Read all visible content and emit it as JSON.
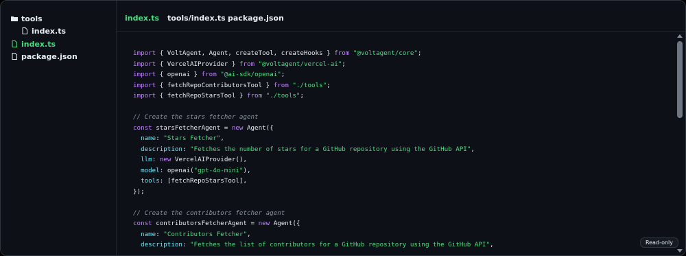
{
  "sidebar": {
    "items": [
      {
        "label": "tools",
        "icon": "folder-icon"
      },
      {
        "label": "index.ts",
        "icon": "file-icon"
      },
      {
        "label": "index.ts",
        "icon": "file-icon",
        "active": true
      },
      {
        "label": "package.json",
        "icon": "file-icon"
      }
    ]
  },
  "tabs": [
    {
      "label": "index.ts",
      "active": true
    },
    {
      "label": "tools/index.ts"
    },
    {
      "label": "package.json"
    }
  ],
  "code": [
    [
      [
        "kw",
        "import"
      ],
      [
        "t",
        " { VoltAgent, Agent, createTool, createHooks } "
      ],
      [
        "kw",
        "from"
      ],
      [
        "t",
        " "
      ],
      [
        "str",
        "\"@voltagent/core\""
      ],
      [
        "t",
        ";"
      ]
    ],
    [
      [
        "kw",
        "import"
      ],
      [
        "t",
        " { VercelAIProvider } "
      ],
      [
        "kw",
        "from"
      ],
      [
        "t",
        " "
      ],
      [
        "str",
        "\"@voltagent/vercel-ai\""
      ],
      [
        "t",
        ";"
      ]
    ],
    [
      [
        "kw",
        "import"
      ],
      [
        "t",
        " { openai } "
      ],
      [
        "kw",
        "from"
      ],
      [
        "t",
        " "
      ],
      [
        "str",
        "\"@ai-sdk/openai\""
      ],
      [
        "t",
        ";"
      ]
    ],
    [
      [
        "kw",
        "import"
      ],
      [
        "t",
        " { fetchRepoContributorsTool } "
      ],
      [
        "kw",
        "from"
      ],
      [
        "t",
        " "
      ],
      [
        "str",
        "\"./tools\""
      ],
      [
        "t",
        ";"
      ]
    ],
    [
      [
        "kw",
        "import"
      ],
      [
        "t",
        " { fetchRepoStarsTool } "
      ],
      [
        "kw",
        "from"
      ],
      [
        "t",
        " "
      ],
      [
        "str",
        "\"./tools\""
      ],
      [
        "t",
        ";"
      ]
    ],
    [],
    [
      [
        "cm",
        "// Create the stars fetcher agent"
      ]
    ],
    [
      [
        "kw",
        "const"
      ],
      [
        "t",
        " starsFetcherAgent = "
      ],
      [
        "kw",
        "new"
      ],
      [
        "t",
        " Agent({"
      ]
    ],
    [
      [
        "t",
        "  "
      ],
      [
        "prop",
        "name"
      ],
      [
        "t",
        ": "
      ],
      [
        "str",
        "\"Stars Fetcher\""
      ],
      [
        "t",
        ","
      ]
    ],
    [
      [
        "t",
        "  "
      ],
      [
        "prop",
        "description"
      ],
      [
        "t",
        ": "
      ],
      [
        "str",
        "\"Fetches the number of stars for a GitHub repository using the GitHub API\""
      ],
      [
        "t",
        ","
      ]
    ],
    [
      [
        "t",
        "  "
      ],
      [
        "prop",
        "llm"
      ],
      [
        "t",
        ": "
      ],
      [
        "kw",
        "new"
      ],
      [
        "t",
        " VercelAIProvider(),"
      ]
    ],
    [
      [
        "t",
        "  "
      ],
      [
        "prop",
        "model"
      ],
      [
        "t",
        ": openai("
      ],
      [
        "str",
        "\"gpt-4o-mini\""
      ],
      [
        "t",
        "),"
      ]
    ],
    [
      [
        "t",
        "  "
      ],
      [
        "prop",
        "tools"
      ],
      [
        "t",
        ": [fetchRepoStarsTool],"
      ]
    ],
    [
      [
        "t",
        "});"
      ]
    ],
    [],
    [
      [
        "cm",
        "// Create the contributors fetcher agent"
      ]
    ],
    [
      [
        "kw",
        "const"
      ],
      [
        "t",
        " contributorsFetcherAgent = "
      ],
      [
        "kw",
        "new"
      ],
      [
        "t",
        " Agent({"
      ]
    ],
    [
      [
        "t",
        "  "
      ],
      [
        "prop",
        "name"
      ],
      [
        "t",
        ": "
      ],
      [
        "str",
        "\"Contributors Fetcher\""
      ],
      [
        "t",
        ","
      ]
    ],
    [
      [
        "t",
        "  "
      ],
      [
        "prop",
        "description"
      ],
      [
        "t",
        ": "
      ],
      [
        "str",
        "\"Fetches the list of contributors for a GitHub repository using the GitHub API\""
      ],
      [
        "t",
        ","
      ]
    ]
  ],
  "badge": {
    "label": "Read-only"
  },
  "colors": {
    "accent": "#4ade80",
    "keyword": "#c084fc",
    "property": "#67e8f9",
    "comment": "#8b949e",
    "background": "#0d1117"
  }
}
